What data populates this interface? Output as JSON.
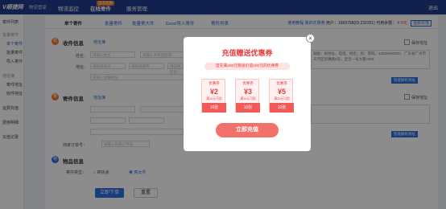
{
  "topbar": {
    "logo": "V顺捷网",
    "logo_sub": "物流管家",
    "nav": [
      "物流监控",
      "在线寄件",
      "服务管理"
    ],
    "badge": "首次优惠",
    "logout": "退出"
  },
  "sidebar": {
    "items": [
      {
        "label": "寄件列表",
        "kind": "item"
      },
      {
        "label": "批量寄件",
        "kind": "group"
      },
      {
        "label": "单个寄件",
        "kind": "active"
      },
      {
        "label": "批量寄件",
        "kind": "item"
      },
      {
        "label": "导入寄件",
        "kind": "item"
      },
      {
        "label": "地址簿",
        "kind": "group"
      },
      {
        "label": "寄件地址",
        "kind": "item"
      },
      {
        "label": "收件地址",
        "kind": "item"
      },
      {
        "label": "运费充值",
        "kind": "item"
      },
      {
        "label": "费用明细",
        "kind": "item"
      },
      {
        "label": "充值记录",
        "kind": "item"
      }
    ]
  },
  "tabs": [
    "单个寄件",
    "批量寄件",
    "批量寄大件",
    "Excel导入寄件",
    "寄件列表"
  ],
  "userbar": {
    "links": "使用教程  我的优惠券",
    "user": "用户：1669758(ID:232351)",
    "balance_label": "可用余额：",
    "balance": "¥ 0元",
    "recharge": "运费充值"
  },
  "receiver": {
    "title": "收件信息",
    "link": "地址簿",
    "name_label": "姓名：",
    "name_placeholder": "请输入姓名",
    "phone_placeholder": "请输入手机或固话",
    "area_label": "地址：",
    "province": "请选择省份",
    "city": "请选择城市",
    "district": "请选择区县",
    "detail_placeholder": "请输入详细地址",
    "save": "保存地址",
    "smart": "智能解析地址",
    "paste_hint": "粘贴：如地址、电话、姓名；如：李四，13000000000，广东省广州市天河区华穗路5号，宝宝一号大厦A601"
  },
  "sender": {
    "title": "寄件信息",
    "link": "地址簿",
    "save": "保存地址",
    "smart": "智能解析地址",
    "waybill_label": "商家订单号：",
    "waybill_placeholder": "请输入商家订单号"
  },
  "package": {
    "title": "物品信息",
    "type_label": "寄件类型：",
    "opt1": "寄快递",
    "opt2": "寄大件"
  },
  "actions": {
    "submit": "立即下单",
    "reset": "重置"
  },
  "modal": {
    "title": "充值赠送优惠券",
    "subtitle": "首充满200元赠送价值100元的优惠券",
    "coupons": [
      {
        "tag": "优惠券",
        "value": "¥2",
        "desc": "满10元可用",
        "count": "10张"
      },
      {
        "tag": "优惠券",
        "value": "¥3",
        "desc": "满15元可用",
        "count": "10张"
      },
      {
        "tag": "优惠券",
        "value": "¥5",
        "desc": "满25元可用",
        "count": "10张"
      }
    ],
    "cta": "立即充值",
    "close": "×"
  }
}
